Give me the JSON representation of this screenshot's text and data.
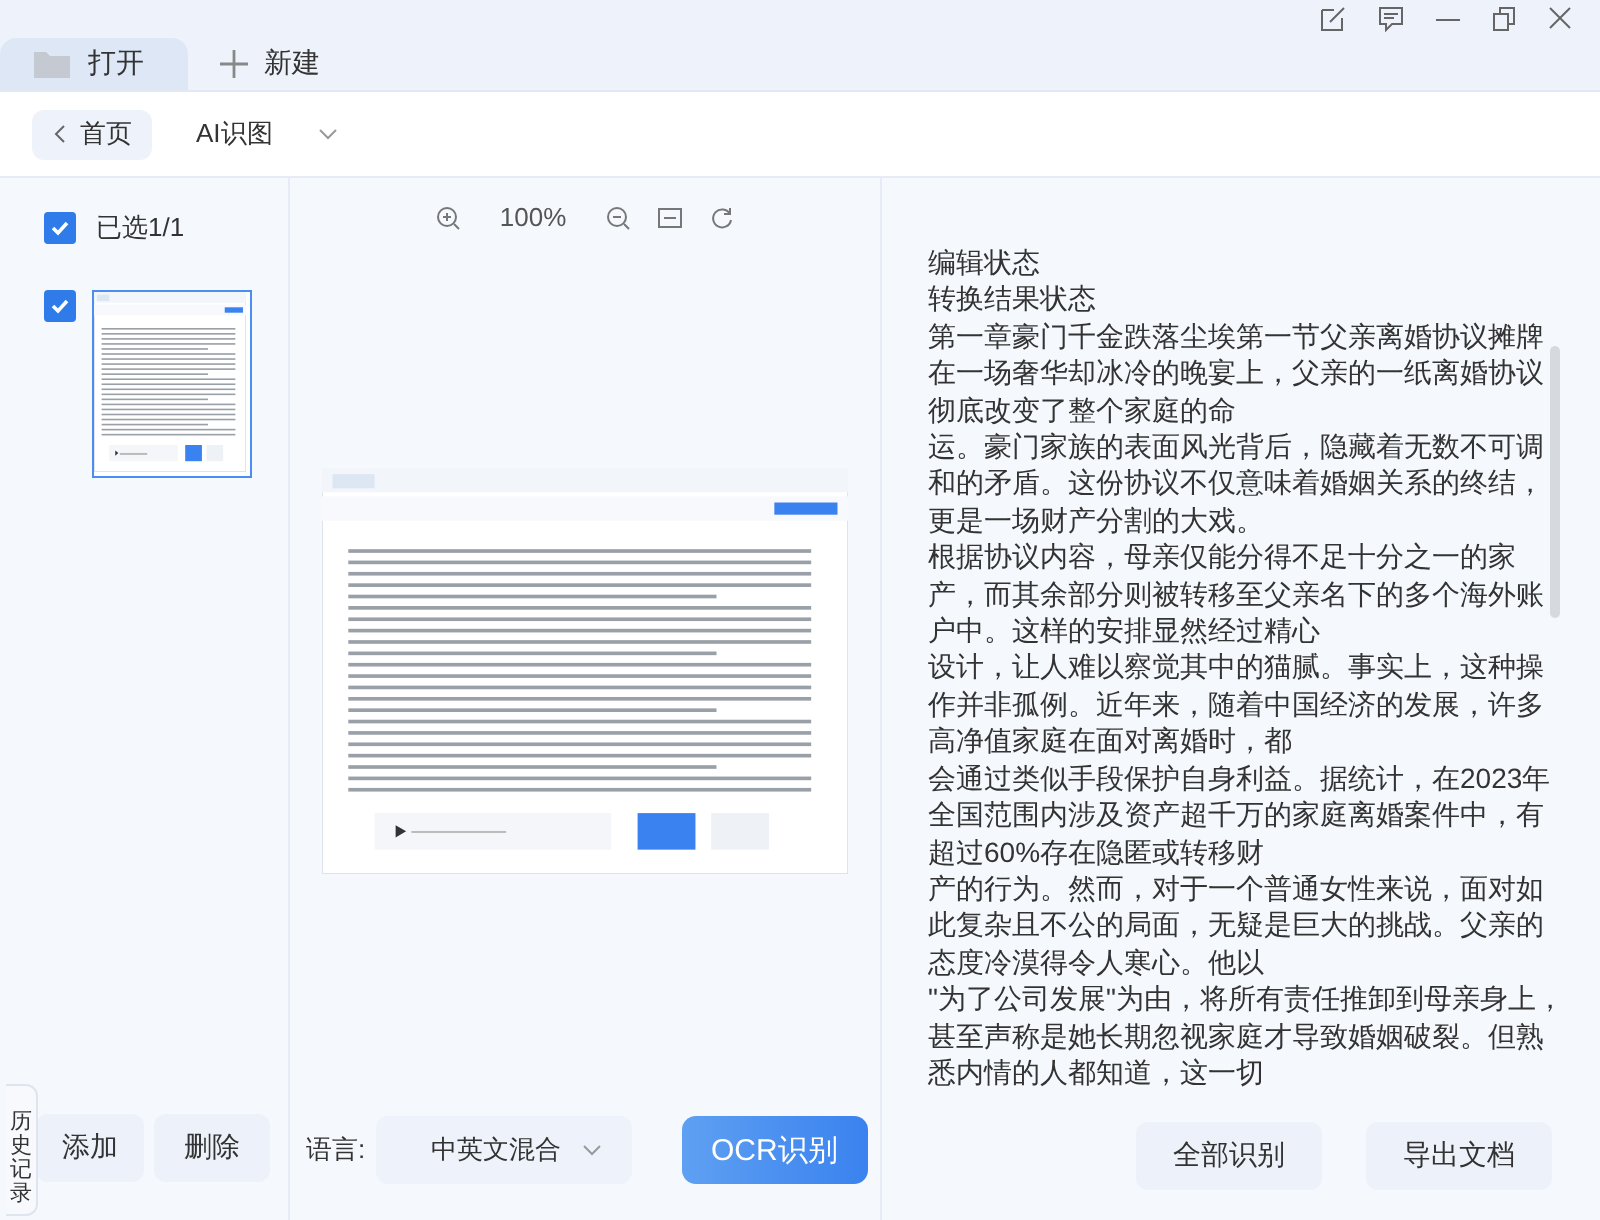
{
  "tabs": [
    {
      "label": "打开",
      "kind": "folder",
      "selected": true
    },
    {
      "label": "新建",
      "kind": "plus",
      "selected": false
    }
  ],
  "nav": {
    "back": "首页",
    "mode": "AI识图"
  },
  "select_all": {
    "label": "已选1/1",
    "checked": true
  },
  "pages": [
    {
      "checked": true,
      "selected": true
    }
  ],
  "zoom": "100%",
  "left_buttons": [
    "添加",
    "删除"
  ],
  "history_tab": "历史记录",
  "language": {
    "label": "语言:",
    "value": "中英文混合"
  },
  "ocr_button": "OCR识别",
  "result_lines": [
    "编辑状态",
    "转换结果状态",
    "第一章豪门千金跌落尘埃第一节父亲离婚协议摊牌",
    "在一场奢华却冰冷的晚宴上，父亲的一纸离婚协议",
    "彻底改变了整个家庭的命",
    "运。豪门家族的表面风光背后，隐藏着无数不可调",
    "和的矛盾。这份协议不仅意味着婚姻关系的终结，",
    "更是一场财产分割的大戏。",
    "根据协议内容，母亲仅能分得不足十分之一的家",
    "产，而其余部分则被转移至父亲名下的多个海外账",
    "户中。这样的安排显然经过精心",
    "设计，让人难以察觉其中的猫腻。事实上，这种操",
    "作并非孤例。近年来，随着中国经济的发展，许多",
    "高净值家庭在面对离婚时，都",
    "会通过类似手段保护自身利益。据统计，在2023年",
    "全国范围内涉及资产超千万的家庭离婚案件中，有",
    "超过60%存在隐匿或转移财",
    "产的行为。然而，对于一个普通女性来说，面对如",
    "此复杂且不公的局面，无疑是巨大的挑战。父亲的",
    "态度冷漠得令人寒心。他以",
    "\"为了公司发展\"为由，将所有责任推卸到母亲身上，",
    "甚至声称是她长期忽视家庭才导致婚姻破裂。但熟",
    "悉内情的人都知道，这一切"
  ],
  "result_buttons": [
    "全部识别",
    "导出文档"
  ]
}
